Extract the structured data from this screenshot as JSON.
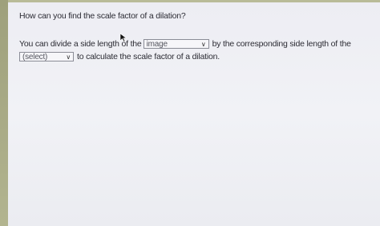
{
  "question": "How can you find the scale factor of a dilation?",
  "sentence": {
    "part1": "You can divide a side length of the",
    "dropdown1_value": "image",
    "part2": "by the corresponding side length of the",
    "dropdown2_value": "(select)",
    "part3": "to calculate the scale factor of a dilation."
  },
  "icons": {
    "dropdown": "chevron-down-icon",
    "pointer": "mouse-cursor-icon"
  }
}
